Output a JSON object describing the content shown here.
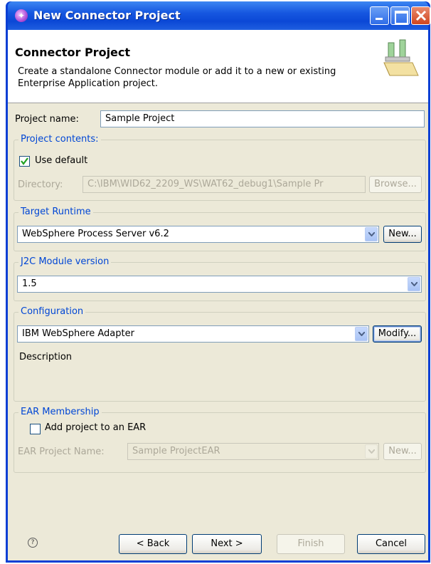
{
  "window": {
    "title": "New Connector Project"
  },
  "header": {
    "title": "Connector Project",
    "description": "Create a standalone Connector module or add it to a new or existing Enterprise Application project."
  },
  "project_name": {
    "label": "Project name:",
    "value": "Sample Project"
  },
  "project_contents": {
    "title": "Project contents:",
    "use_default_label": "Use default",
    "use_default_checked": true,
    "directory_label": "Directory:",
    "directory_value": "C:\\IBM\\WID62_2209_WS\\WAT62_debug1\\Sample Pr",
    "browse_label": "Browse..."
  },
  "target_runtime": {
    "title": "Target Runtime",
    "selected": "WebSphere Process Server v6.2",
    "new_label": "New..."
  },
  "j2c_module": {
    "title": "J2C Module version",
    "selected": "1.5"
  },
  "configuration": {
    "title": "Configuration",
    "selected": "IBM WebSphere Adapter",
    "modify_label": "Modify...",
    "description_label": "Description"
  },
  "ear_membership": {
    "title": "EAR Membership",
    "add_label": "Add project to an EAR",
    "add_checked": false,
    "ear_name_label": "EAR Project Name:",
    "ear_name_value": "Sample ProjectEAR",
    "new_label": "New..."
  },
  "footer": {
    "back_label": "< Back",
    "next_label": "Next >",
    "finish_label": "Finish",
    "cancel_label": "Cancel"
  }
}
